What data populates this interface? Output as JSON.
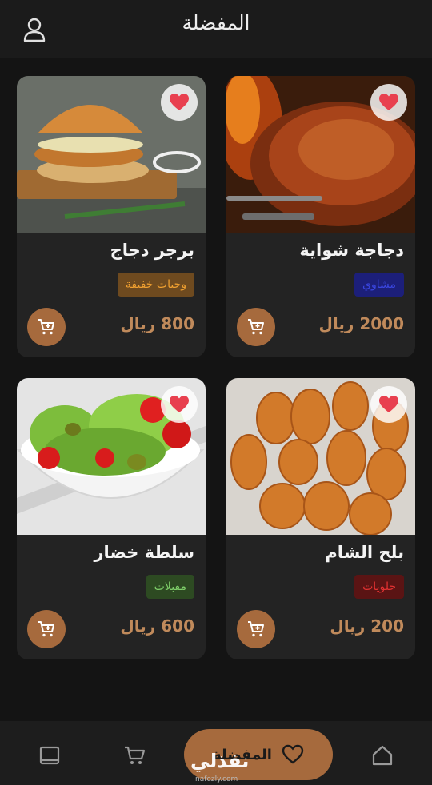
{
  "header": {
    "title": "المفضلة",
    "profile_icon": "user-icon"
  },
  "colors": {
    "accent": "#a66a3d",
    "price": "#c08a5b",
    "heart": "#e8404f",
    "card": "#232323"
  },
  "items": [
    {
      "name": "دجاجة شواية",
      "tag": "مشاوي",
      "price": "2000 ريال",
      "tag_bg": "#1c1f7a",
      "tag_color": "#3a46e0"
    },
    {
      "name": "برجر دجاج",
      "tag": "وجبات خفيفة",
      "price": "800 ريال",
      "tag_bg": "#6e4a1f",
      "tag_color": "#f0a030"
    },
    {
      "name": "بلح الشام",
      "tag": "حلويات",
      "price": "200 ريال",
      "tag_bg": "#5a1414",
      "tag_color": "#e23232"
    },
    {
      "name": "سلطة خضار",
      "tag": "مقبلات",
      "price": "600 ريال",
      "tag_bg": "#2d4a22",
      "tag_color": "#7fd06a"
    }
  ],
  "bottom_nav": {
    "active_label": "المفضلة",
    "icons": [
      "home-icon",
      "heart-icon",
      "cart-icon",
      "orders-icon"
    ]
  },
  "watermark": {
    "text": "نفذلي",
    "sub": "nafezly.com"
  }
}
